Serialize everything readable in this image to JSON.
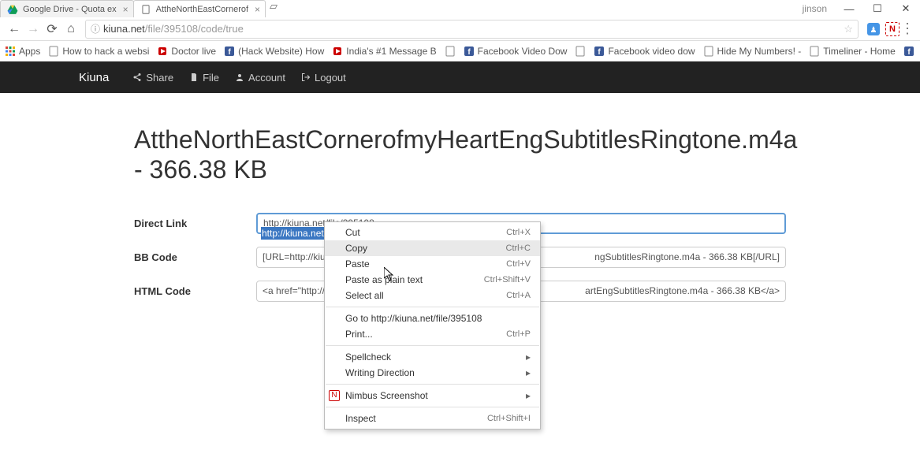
{
  "titlebar": {
    "tabs": [
      {
        "title": "Google Drive - Quota ex"
      },
      {
        "title": "AttheNorthEastCornerof"
      }
    ],
    "user": "jinson"
  },
  "omnibox": {
    "host": "kiuna.net",
    "path": "/file/395108/code/true"
  },
  "bookmarks": {
    "apps": "Apps",
    "items": [
      "How to hack a websi",
      "Doctor live",
      "(Hack Website) How",
      "India's #1 Message B",
      "Facebook Video Dow",
      "Facebook video dow",
      "Hide My Numbers! -",
      "Timeliner - Home"
    ]
  },
  "nav": {
    "brand": "Kiuna",
    "share": "Share",
    "file": "File",
    "account": "Account",
    "logout": "Logout"
  },
  "page": {
    "title": "AttheNorthEastCornerofmyHeartEngSubtitlesRingtone.m4a - 366.38 KB",
    "direct_label": "Direct Link",
    "direct_value": "http://kiuna.net/file/395108",
    "direct_selected": "http://kiuna.net/fi",
    "bb_label": "BB Code",
    "bb_value_left": "[URL=http://kiu",
    "bb_value_right": "ngSubtitlesRingtone.m4a - 366.38 KB[/URL]",
    "html_label": "HTML Code",
    "html_value_left": "<a href=\"http://",
    "html_value_right": "artEngSubtitlesRingtone.m4a - 366.38 KB</a>"
  },
  "ctx": {
    "cut": "Cut",
    "cut_s": "Ctrl+X",
    "copy": "Copy",
    "copy_s": "Ctrl+C",
    "paste": "Paste",
    "paste_s": "Ctrl+V",
    "paste_plain": "Paste as plain text",
    "paste_plain_s": "Ctrl+Shift+V",
    "select_all": "Select all",
    "select_all_s": "Ctrl+A",
    "goto": "Go to http://kiuna.net/file/395108",
    "print": "Print...",
    "print_s": "Ctrl+P",
    "spell": "Spellcheck",
    "writing": "Writing Direction",
    "nimbus": "Nimbus Screenshot",
    "inspect": "Inspect",
    "inspect_s": "Ctrl+Shift+I"
  }
}
